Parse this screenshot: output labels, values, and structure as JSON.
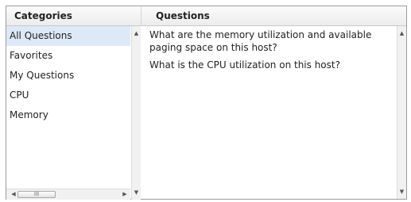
{
  "headers": {
    "categories": "Categories",
    "questions": "Questions"
  },
  "categories": [
    {
      "label": "All Questions",
      "selected": true
    },
    {
      "label": "Favorites",
      "selected": false
    },
    {
      "label": "My Questions",
      "selected": false
    },
    {
      "label": "CPU",
      "selected": false
    },
    {
      "label": "Memory",
      "selected": false
    }
  ],
  "questions": [
    "What are the memory utilization and available paging space on this host?",
    "What is the CPU utilization on this host?"
  ],
  "scrollbar": {
    "thumb_grip": "III"
  },
  "colors": {
    "selection": "#dde9f7",
    "border": "#9c9c9c"
  }
}
